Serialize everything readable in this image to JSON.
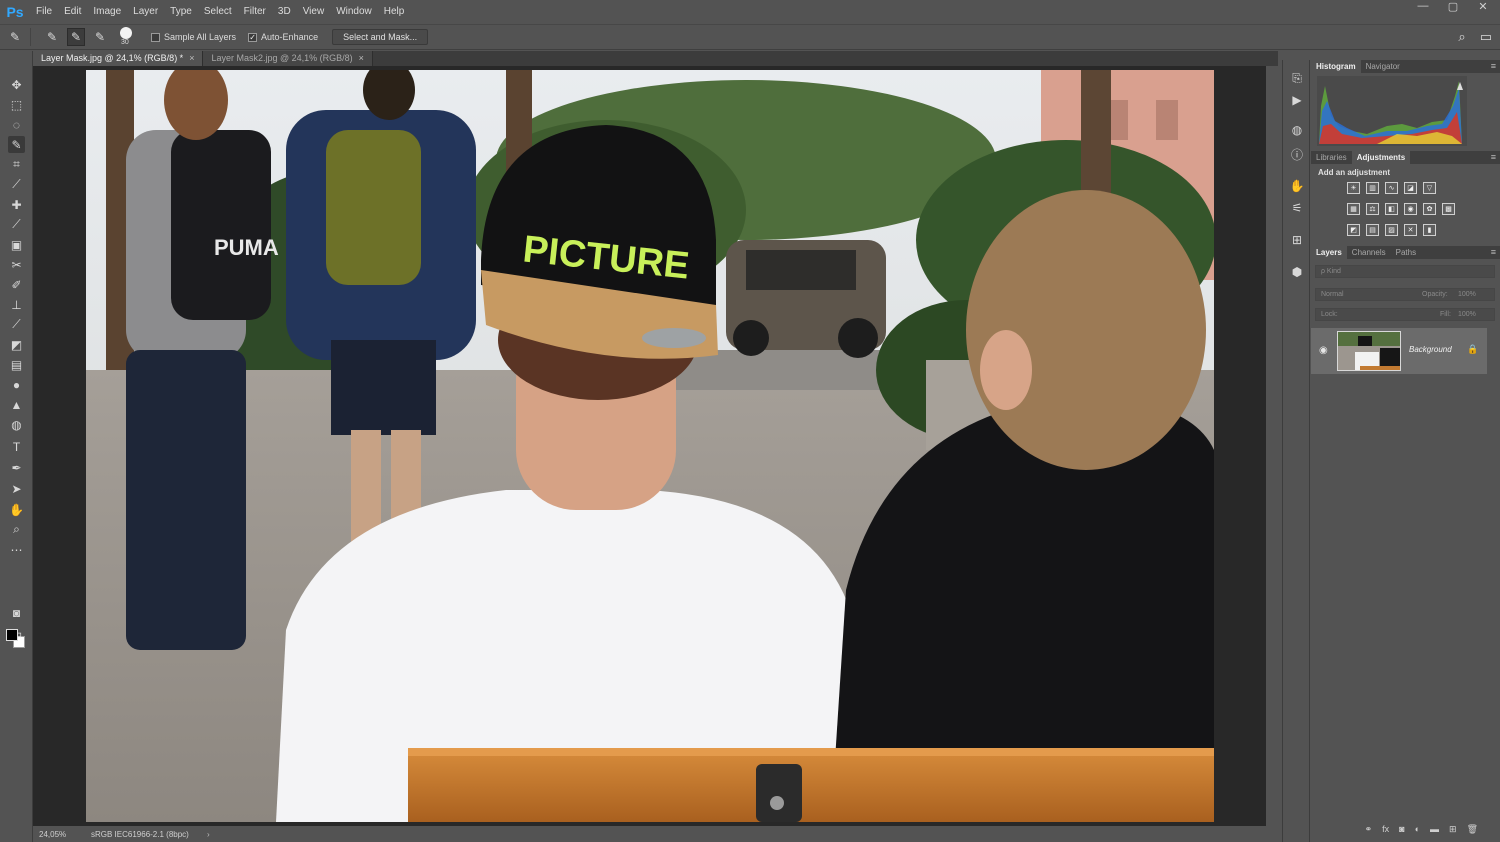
{
  "app": {
    "logo": "Ps"
  },
  "menu": [
    "File",
    "Edit",
    "Image",
    "Layer",
    "Type",
    "Select",
    "Filter",
    "3D",
    "View",
    "Window",
    "Help"
  ],
  "window_controls": {
    "minimize": "—",
    "restore": "▢",
    "close": "✕"
  },
  "options": {
    "brush_size": "30",
    "sample_all_layers": "Sample All Layers",
    "sample_all_layers_checked": false,
    "auto_enhance": "Auto-Enhance",
    "auto_enhance_checked": true,
    "select_and_mask": "Select and Mask..."
  },
  "tabs": [
    {
      "label": "Layer Mask.jpg @ 24,1% (RGB/8) *",
      "active": true
    },
    {
      "label": "Layer Mask2.jpg @ 24,1% (RGB/8)",
      "active": false
    }
  ],
  "tab_close": "×",
  "status": {
    "zoom": "24,05%",
    "profile": "sRGB IEC61966-2.1 (8bpc)",
    "arrow": "›"
  },
  "photo_text": {
    "cap": "PICTURE",
    "bag": "PUMA"
  },
  "panels": {
    "top_tabs": [
      "Histogram",
      "Navigator"
    ],
    "mid_tabs": [
      "Libraries",
      "Adjustments"
    ],
    "add_adjustment": "Add an adjustment",
    "layer_tabs": [
      "Layers",
      "Channels",
      "Paths"
    ],
    "kind_placeholder": "ρ Kind",
    "blend_mode": "Normal",
    "opacity_label": "Opacity:",
    "opacity_value": "100%",
    "lock_label": "Lock:",
    "fill_label": "Fill:",
    "fill_value": "100%",
    "layer_name": "Background",
    "menu_glyph": "≡"
  },
  "colors": {
    "accent": "#31a8ff",
    "panel": "#535353",
    "canvas_bg": "#282828"
  }
}
